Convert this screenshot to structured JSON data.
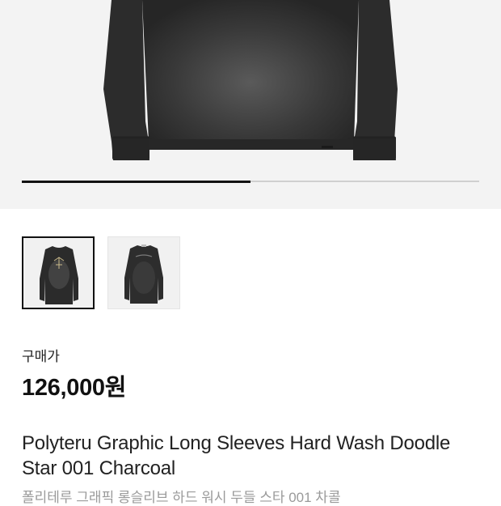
{
  "gallery": {
    "main_image": "charcoal-long-sleeve-shirt-photo",
    "progress": 0.5,
    "thumbnails": [
      {
        "icon": "shirt-front-thumbnail",
        "selected": true
      },
      {
        "icon": "shirt-back-thumbnail",
        "selected": false
      }
    ]
  },
  "product": {
    "price_label": "구매가",
    "price": "126,000원",
    "name_en": "Polyteru Graphic Long Sleeves Hard Wash Doodle Star 001 Charcoal",
    "name_ko": "폴리테루 그래픽 롱슬리브 하드 워시 두들 스타 001 차콜"
  },
  "colors": {
    "hero_bg": "#f3f3f3",
    "shirt": "#2e2e2e",
    "secondary_text": "#9a9a9a"
  }
}
